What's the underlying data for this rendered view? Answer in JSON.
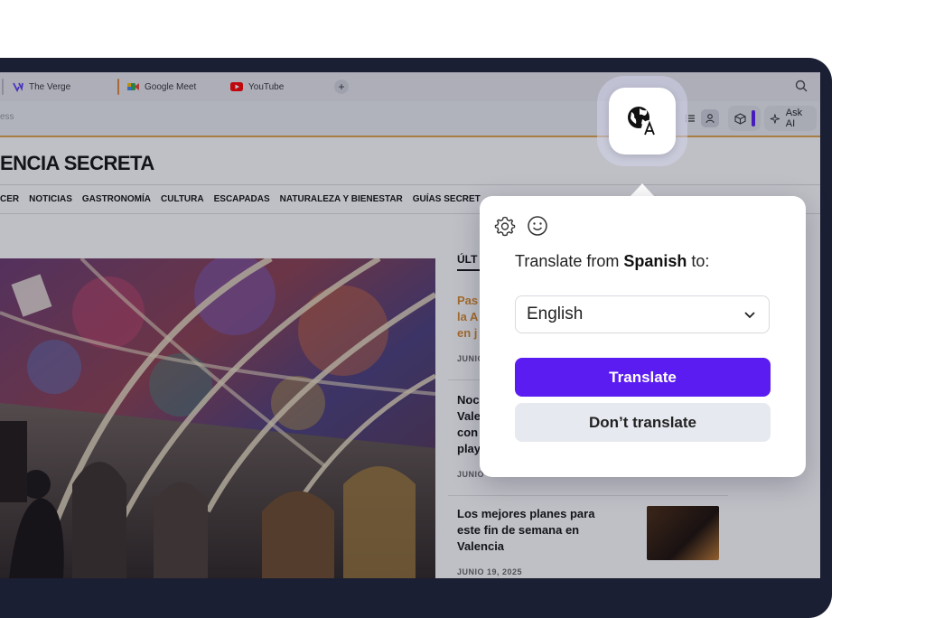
{
  "tabs": [
    {
      "label": "The Verge",
      "icon": "verge-logo-icon",
      "color": "#5b3cf0"
    },
    {
      "label": "Google Meet",
      "icon": "google-meet-icon",
      "color": "#34a853"
    },
    {
      "label": "YouTube",
      "icon": "youtube-icon",
      "color": "#ff0000"
    }
  ],
  "address": {
    "partial_text": "ess"
  },
  "toolbar": {
    "ask_ai_label": "Ask AI"
  },
  "site": {
    "logo_text": "ENCIA SECRETA",
    "nav": [
      "CER",
      "NOTICIAS",
      "GASTRONOMÍA",
      "CULTURA",
      "ESCAPADAS",
      "NATURALEZA Y BIENESTAR",
      "GUÍAS SECRET"
    ],
    "side_heading": "ÚLT",
    "articles": [
      {
        "lines": [
          "Pas",
          "la A",
          "en j"
        ],
        "date": "JUNIO"
      },
      {
        "lines": [
          "Noc",
          "Vale",
          "con",
          "play"
        ],
        "date": "JUNIO"
      },
      {
        "lines": [
          "Los mejores planes para",
          "este fin de semana en",
          "Valencia"
        ],
        "date": "JUNIO 19, 2025"
      }
    ]
  },
  "translate_popup": {
    "title_prefix": "Translate from ",
    "source_language": "Spanish",
    "title_suffix": " to:",
    "target_language": "English",
    "translate_label": "Translate",
    "dont_translate_label": "Don’t translate"
  },
  "colors": {
    "accent": "#5a1cf0",
    "site_orange": "#d98a2b"
  }
}
